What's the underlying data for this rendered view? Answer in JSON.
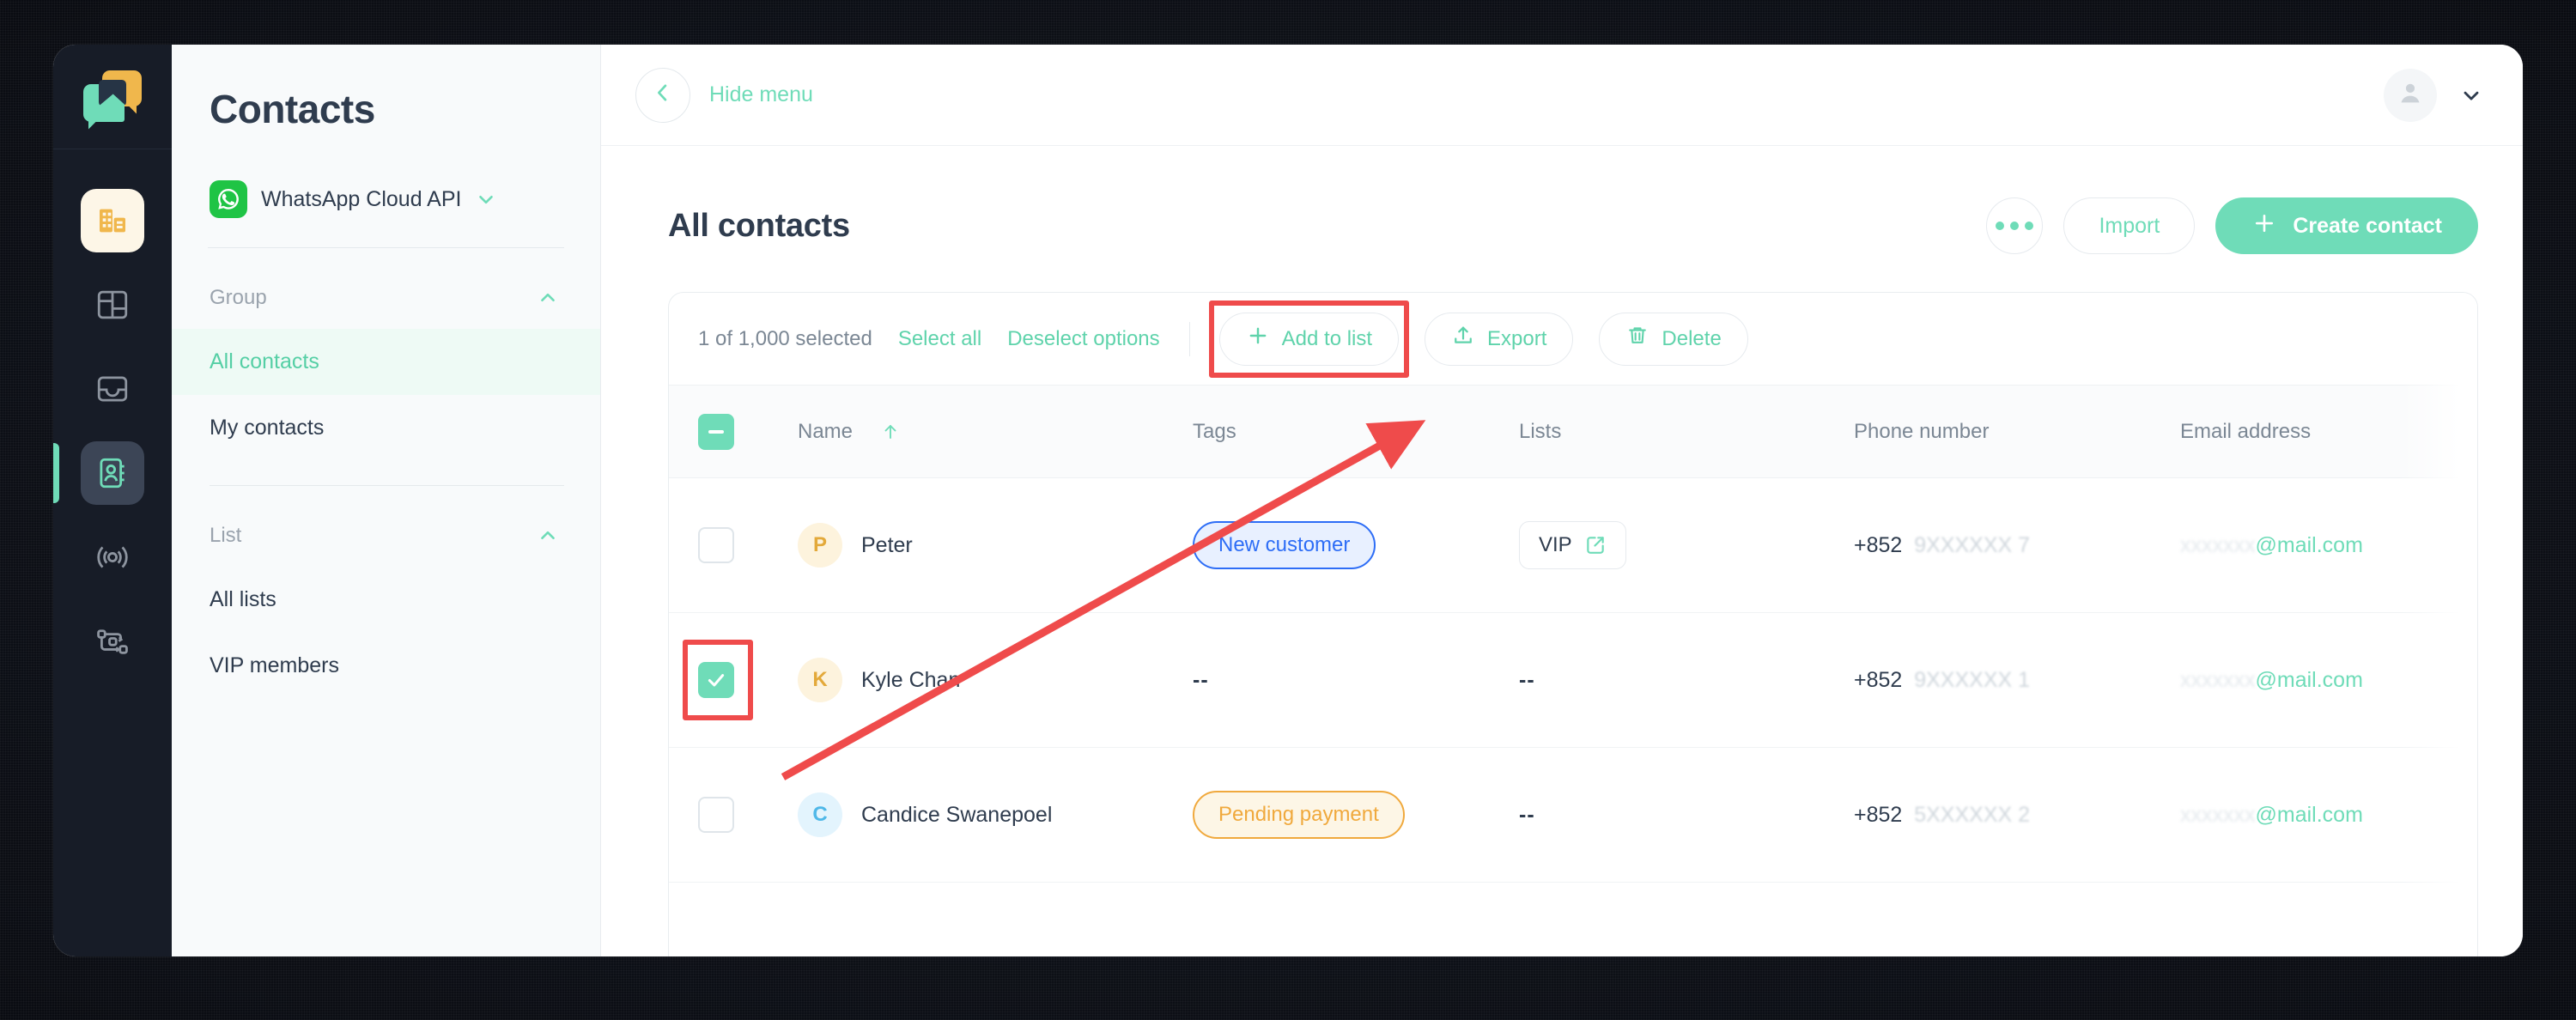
{
  "window": {
    "rail": {
      "logo": "respond-io-logo",
      "items": [
        {
          "name": "workspace-switcher",
          "icon": "building-icon",
          "active": false
        },
        {
          "name": "dashboard",
          "icon": "dashboard-icon",
          "active": false
        },
        {
          "name": "inbox",
          "icon": "inbox-icon",
          "active": false
        },
        {
          "name": "contacts",
          "icon": "contact-book-icon",
          "active": true
        },
        {
          "name": "broadcasts",
          "icon": "broadcast-icon",
          "active": false
        },
        {
          "name": "workflows",
          "icon": "workflow-icon",
          "active": false
        }
      ]
    },
    "menu": {
      "title": "Contacts",
      "workspace": {
        "name": "WhatsApp Cloud API",
        "icon": "whatsapp-icon",
        "caret": "chevron-down-icon"
      },
      "sections": [
        {
          "label": "Group",
          "caret": "chevron-up-icon",
          "items": [
            {
              "label": "All contacts",
              "active": true
            },
            {
              "label": "My contacts",
              "active": false
            }
          ]
        },
        {
          "label": "List",
          "caret": "chevron-up-icon",
          "items": [
            {
              "label": "All lists",
              "active": false
            },
            {
              "label": "VIP members",
              "active": false
            }
          ]
        }
      ]
    },
    "topbar": {
      "back_icon": "chevron-left-icon",
      "hide_menu_label": "Hide menu",
      "avatar_icon": "user-avatar-icon",
      "avatar_caret": "chevron-down-icon"
    },
    "page": {
      "title": "All contacts",
      "actions": {
        "more_label": "···",
        "more_icon": "ellipsis-icon",
        "import_label": "Import",
        "create_label": "Create contact",
        "create_icon": "plus-icon"
      }
    },
    "bulkbar": {
      "selected_text": "1 of 1,000 selected",
      "select_all_label": "Select all",
      "deselect_label": "Deselect options",
      "add_to_list_label": "Add to list",
      "add_to_list_icon": "plus-icon",
      "export_label": "Export",
      "export_icon": "upload-icon",
      "delete_label": "Delete",
      "delete_icon": "trash-icon"
    },
    "table": {
      "columns": [
        {
          "key": "check",
          "label": ""
        },
        {
          "key": "name",
          "label": "Name",
          "sort_icon": "arrow-up-icon"
        },
        {
          "key": "tags",
          "label": "Tags"
        },
        {
          "key": "lists",
          "label": "Lists"
        },
        {
          "key": "phone",
          "label": "Phone number"
        },
        {
          "key": "email",
          "label": "Email address"
        }
      ],
      "header_checkbox_state": "indeterminate",
      "rows": [
        {
          "checked": false,
          "avatar_letter": "P",
          "avatar_color": "yellow",
          "name": "Peter",
          "tag": {
            "label": "New customer",
            "color": "blue"
          },
          "list": {
            "label": "VIP",
            "icon": "external-link-icon"
          },
          "phone_prefix": "+852",
          "phone_masked_start": "9",
          "phone_masked_end": "7",
          "email_masked": "xxxxxxx",
          "email_domain": "@mail.com"
        },
        {
          "checked": true,
          "avatar_letter": "K",
          "avatar_color": "yellow",
          "name": "Kyle Chan",
          "tag": {
            "label": "--",
            "color": "none"
          },
          "list": {
            "label": "--",
            "icon": ""
          },
          "phone_prefix": "+852",
          "phone_masked_start": "9",
          "phone_masked_end": "1",
          "email_masked": "xxxxxxx",
          "email_domain": "@mail.com"
        },
        {
          "checked": false,
          "avatar_letter": "C",
          "avatar_color": "blue",
          "name": "Candice Swanepoel",
          "tag": {
            "label": "Pending payment",
            "color": "orange"
          },
          "list": {
            "label": "--",
            "icon": ""
          },
          "phone_prefix": "+852",
          "phone_masked_start": "5",
          "phone_masked_end": "2",
          "email_masked": "xxxxxxx",
          "email_domain": "@mail.com"
        }
      ]
    },
    "annotation": {
      "color": "#ef4b4b",
      "arrow_from": "row-checkbox-kyle-chan",
      "arrow_to": "add-to-list-button",
      "highlight_boxes": [
        "add-to-list-button",
        "row-checkbox-kyle-chan"
      ]
    }
  }
}
